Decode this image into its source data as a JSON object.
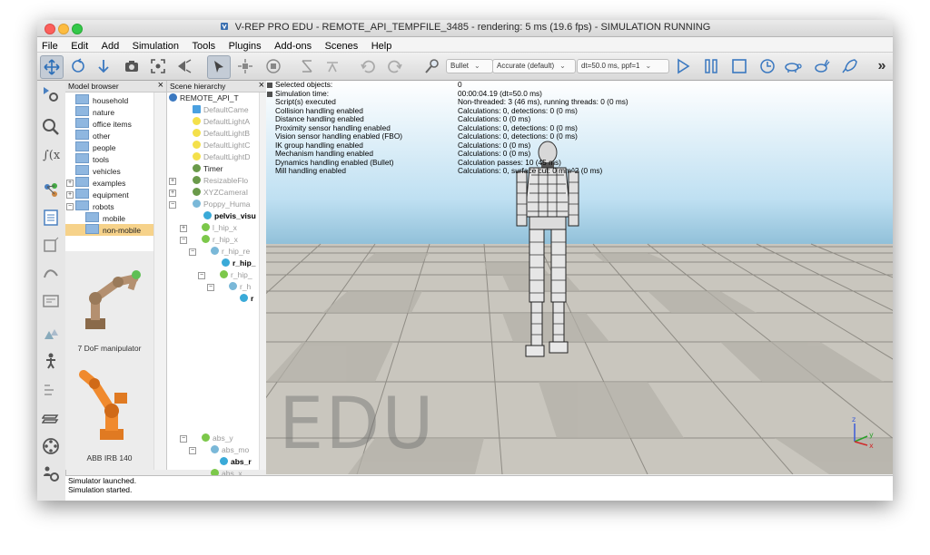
{
  "window": {
    "title": "V-REP PRO EDU - REMOTE_API_TEMPFILE_3485 - rendering: 5 ms (19.6 fps) - SIMULATION RUNNING"
  },
  "menu": [
    "File",
    "Edit",
    "Add",
    "Simulation",
    "Tools",
    "Plugins",
    "Add-ons",
    "Scenes",
    "Help"
  ],
  "toolbar": {
    "engine": "Bullet",
    "accuracy": "Accurate (default)",
    "timestep": "dt=50.0 ms, ppf=1",
    "more": "»"
  },
  "model_browser": {
    "title": "Model browser",
    "folders": [
      "household",
      "nature",
      "office items",
      "other",
      "people",
      "tools",
      "vehicles",
      "examples",
      "equipment",
      "robots",
      "mobile",
      "non-mobile"
    ],
    "previews": [
      "7 DoF manipulator",
      "ABB IRB 140"
    ]
  },
  "scene_hierarchy": {
    "title": "Scene hierarchy",
    "nodes": [
      "REMOTE_API_T",
      "DefaultCame",
      "DefaultLightA",
      "DefaultLightB",
      "DefaultLightC",
      "DefaultLightD",
      "Timer",
      "ResizableFlo",
      "XYZCameraI",
      "Poppy_Huma",
      "pelvis_visu",
      "l_hip_x",
      "r_hip_x",
      "r_hip_re",
      "r_hip_",
      "r_hip_",
      "r_h",
      "r",
      "abs_y",
      "abs_mo",
      "abs_r",
      "abs_x"
    ]
  },
  "simulation_info": {
    "rows": [
      {
        "label": "Selected objects:",
        "value": "0"
      },
      {
        "label": "Simulation time:",
        "value": "00:00:04.19 (dt=50.0 ms)"
      },
      {
        "label": "Script(s) executed",
        "value": "Non-threaded: 3 (46 ms), running threads: 0 (0 ms)"
      },
      {
        "label": "Collision handling enabled",
        "value": "Calculations: 0, detections: 0 (0 ms)"
      },
      {
        "label": "Distance handling enabled",
        "value": "Calculations: 0 (0 ms)"
      },
      {
        "label": "Proximity sensor handling enabled",
        "value": "Calculations: 0, detections: 0 (0 ms)"
      },
      {
        "label": "Vision sensor handling enabled (FBO)",
        "value": "Calculations: 0, detections: 0 (0 ms)"
      },
      {
        "label": "IK group handling enabled",
        "value": "Calculations: 0 (0 ms)"
      },
      {
        "label": "Mechanism handling enabled",
        "value": "Calculations: 0 (0 ms)"
      },
      {
        "label": "Dynamics handling enabled (Bullet)",
        "value": "Calculation passes: 10 (45 ms)"
      },
      {
        "label": "Mill handling enabled",
        "value": "Calculations: 0, surface cut: 0 mm^2 (0 ms)"
      }
    ]
  },
  "viewport": {
    "watermark": "EDU",
    "axis_labels": [
      "z",
      "y",
      "x"
    ]
  },
  "console": {
    "lines": [
      "Simulator launched.",
      "Simulation started."
    ]
  },
  "colors": {
    "selection": "#f6d28a",
    "sky": "#8fbfd8",
    "floor_light": "#d9d6cf",
    "floor_dark": "#aaa79f",
    "robot_orange": "#f08a2e"
  }
}
